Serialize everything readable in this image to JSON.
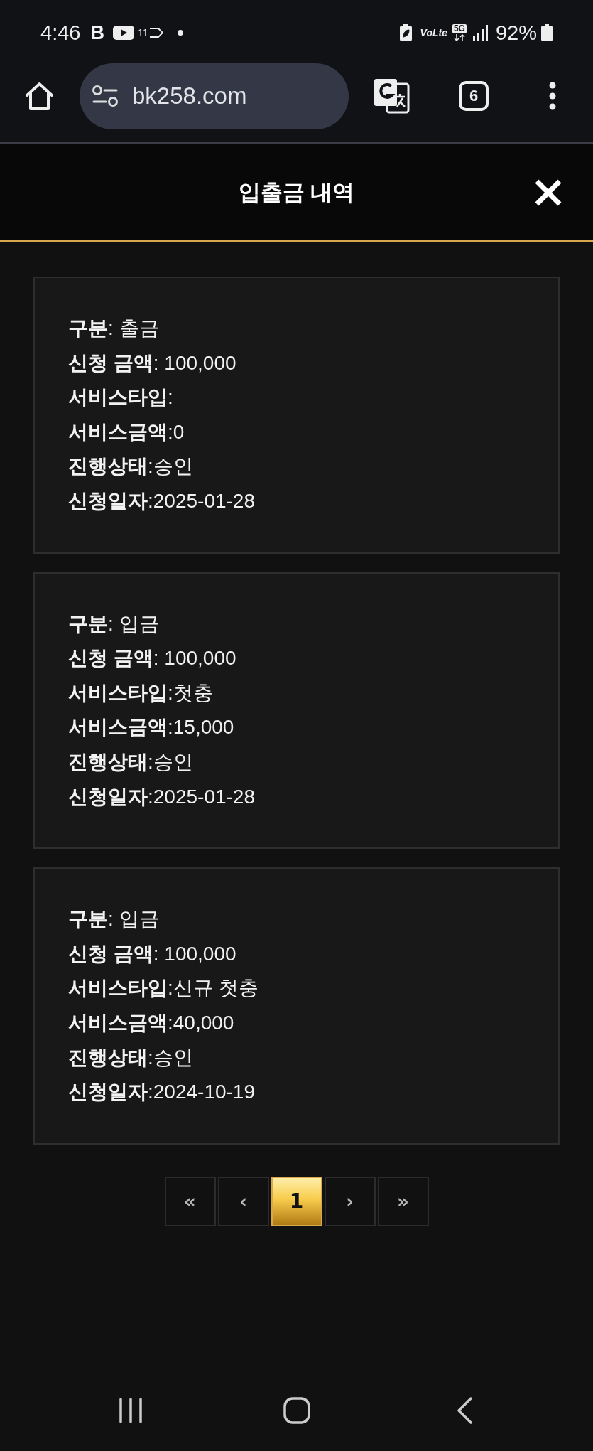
{
  "status_bar": {
    "time": "4:46",
    "app_logo": "B",
    "notification_count": "11",
    "network_label": "VoLte",
    "network_type": "5G",
    "battery": "92%"
  },
  "browser": {
    "url": "bk258.com",
    "tab_count": "6"
  },
  "page_header": {
    "title": "입출금 내역"
  },
  "records": [
    {
      "category": "**구분**: 출금",
      "requested_amount": "**신청 금액**: 100,000",
      "service_type": "**서비스타입**:",
      "service_amount": "**서비스금액**:0",
      "status": "**진행상태**:승인",
      "request_date": "**신청일자**:2025-01-28"
    },
    {
      "category": "**구분**: 입금",
      "requested_amount": "**신청 금액**: 100,000",
      "service_type": "**서비스타입**:첫충",
      "service_amount": "**서비스금액**:15,000",
      "status": "**진행상태**:승인",
      "request_date": "**신청일자**:2025-01-28"
    },
    {
      "category": "**구분**: 입금",
      "requested_amount": "**신청 금액**: 100,000",
      "service_type": "**서비스타입**:신규 첫충",
      "service_amount": "**서비스금액**:40,000",
      "status": "**진행상태**:승인",
      "request_date": "**신청일자**:2024-10-19"
    }
  ],
  "pagination": [
    {
      "label": "«",
      "selected": false
    },
    {
      "label": "‹",
      "selected": false
    },
    {
      "label": "1",
      "selected": true
    },
    {
      "label": "›",
      "selected": false
    },
    {
      "label": "»",
      "selected": false
    }
  ]
}
